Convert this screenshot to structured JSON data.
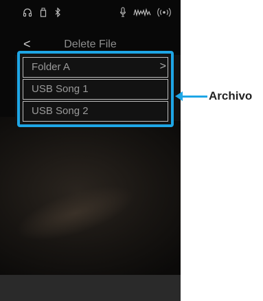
{
  "status_bar": {
    "icons": [
      "headphones-icon",
      "usb-icon",
      "bluetooth-icon",
      "microphone-icon",
      "audio-recorder-icon",
      "wireless-icon"
    ]
  },
  "header": {
    "back_symbol": "<",
    "title": "Delete File"
  },
  "file_list": {
    "items": [
      {
        "label": "Folder A",
        "type": "folder",
        "chevron": ">"
      },
      {
        "label": "USB Song 1",
        "type": "file"
      },
      {
        "label": "USB Song 2",
        "type": "file"
      }
    ]
  },
  "annotation": {
    "label": "Archivo",
    "color": "#1ea6e6"
  }
}
